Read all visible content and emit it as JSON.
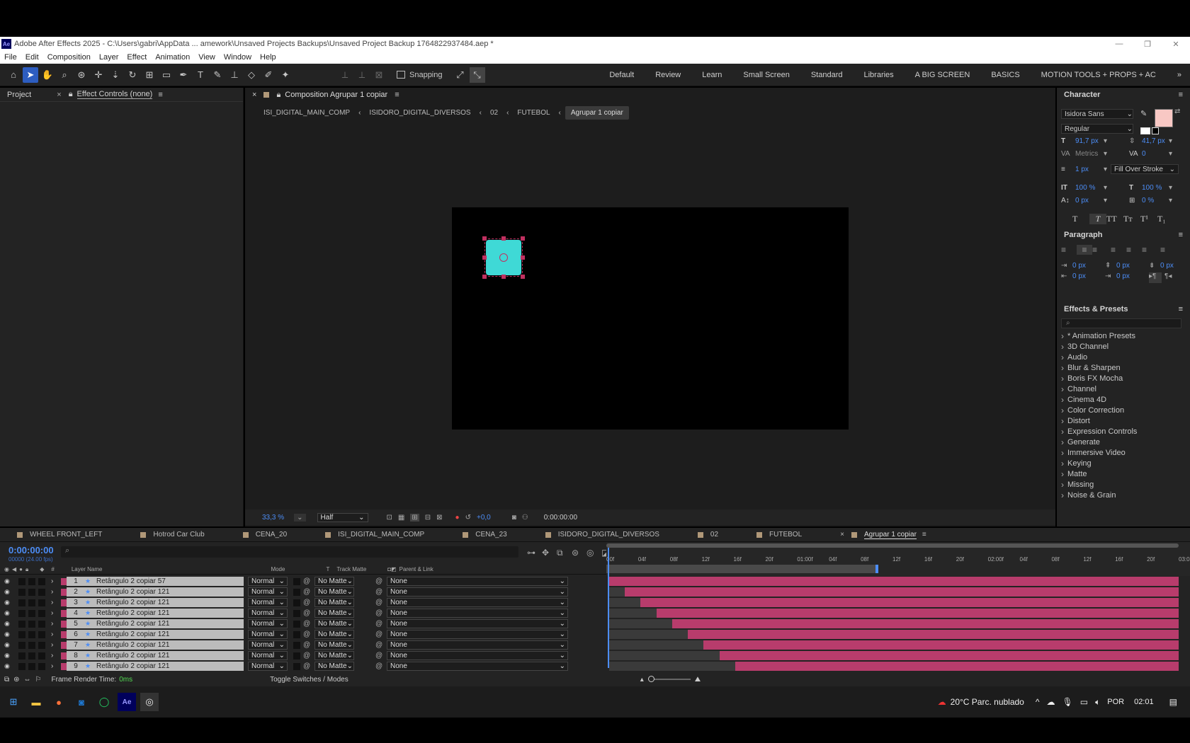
{
  "window": {
    "title": "Adobe After Effects 2025 - C:\\Users\\gabri\\AppData ... amework\\Unsaved Projects Backups\\Unsaved Project Backup 1764822937484.aep *",
    "app_icon": "Ae"
  },
  "menu": [
    "File",
    "Edit",
    "Composition",
    "Layer",
    "Effect",
    "Animation",
    "View",
    "Window",
    "Help"
  ],
  "toolbar": {
    "snapping_label": "Snapping",
    "workspaces": [
      "Default",
      "Review",
      "Learn",
      "Small Screen",
      "Standard",
      "Libraries",
      "A BIG SCREEN",
      "BASICS",
      "MOTION TOOLS + PROPS + AC"
    ]
  },
  "left_panel": {
    "tab_project": "Project",
    "tab_effect": "Effect Controls (none)"
  },
  "comp_panel": {
    "tab": "Composition Agrupar 1 copiar",
    "breadcrumbs": [
      "ISI_DIGITAL_MAIN_COMP",
      "ISIDORO_DIGITAL_DIVERSOS",
      "02",
      "FUTEBOL",
      "Agrupar 1 copiar"
    ],
    "zoom": "33,3 %",
    "resolution": "Half",
    "exposure": "+0,0",
    "timecode": "0:00:00:00",
    "shape_color": "#3fd9d6"
  },
  "character": {
    "title": "Character",
    "font": "Isidora Sans",
    "style": "Regular",
    "size": "91,7 px",
    "leading": "41,7 px",
    "kerning": "Metrics",
    "tracking": "0",
    "stroke_width": "1 px",
    "stroke_mode": "Fill Over Stroke",
    "vscale": "100 %",
    "hscale": "100 %",
    "baseline": "0 px",
    "tsume": "0 %",
    "fill_color": "#f8c8c4"
  },
  "paragraph": {
    "title": "Paragraph",
    "indent_left": "0 px",
    "indent_right": "0 px",
    "space_before": "0 px",
    "indent_first": "0 px",
    "space_after": "0 px",
    "last": "0 px"
  },
  "effects": {
    "title": "Effects & Presets",
    "items": [
      "* Animation Presets",
      "3D Channel",
      "Audio",
      "Blur & Sharpen",
      "Boris FX Mocha",
      "Channel",
      "Cinema 4D",
      "Color Correction",
      "Distort",
      "Expression Controls",
      "Generate",
      "Immersive Video",
      "Keying",
      "Matte",
      "Missing",
      "Noise & Grain"
    ]
  },
  "timeline": {
    "tabs": [
      "WHEEL FRONT_LEFT",
      "Hotrod Car Club",
      "CENA_20",
      "ISI_DIGITAL_MAIN_COMP",
      "CENA_23",
      "ISIDORO_DIGITAL_DIVERSOS",
      "02",
      "FUTEBOL",
      "Agrupar 1 copiar"
    ],
    "timecode": "0:00:00:00",
    "fps": "00000 (24.00 fps)",
    "col_layer_name": "Layer Name",
    "col_mode": "Mode",
    "col_t": "T",
    "col_track": "Track Matte",
    "col_parent": "Parent & Link",
    "ruler": [
      "00f",
      "04f",
      "08f",
      "12f",
      "16f",
      "20f",
      "01:00f",
      "04f",
      "08f",
      "12f",
      "16f",
      "20f",
      "02:00f",
      "04f",
      "08f",
      "12f",
      "16f",
      "20f",
      "03:0"
    ],
    "layers": [
      {
        "num": "1",
        "name": "Retângulo 2 copiar 57",
        "mode": "Normal",
        "matte": "No Matte",
        "parent": "None",
        "start": 0.0
      },
      {
        "num": "2",
        "name": "Retângulo 2 copiar 121",
        "mode": "Normal",
        "matte": "No Matte",
        "parent": "None",
        "start": 0.027
      },
      {
        "num": "3",
        "name": "Retângulo 2 copiar 121",
        "mode": "Normal",
        "matte": "No Matte",
        "parent": "None",
        "start": 0.055
      },
      {
        "num": "4",
        "name": "Retângulo 2 copiar 121",
        "mode": "Normal",
        "matte": "No Matte",
        "parent": "None",
        "start": 0.083
      },
      {
        "num": "5",
        "name": "Retângulo 2 copiar 121",
        "mode": "Normal",
        "matte": "No Matte",
        "parent": "None",
        "start": 0.111
      },
      {
        "num": "6",
        "name": "Retângulo 2 copiar 121",
        "mode": "Normal",
        "matte": "No Matte",
        "parent": "None",
        "start": 0.138
      },
      {
        "num": "7",
        "name": "Retângulo 2 copiar 121",
        "mode": "Normal",
        "matte": "No Matte",
        "parent": "None",
        "start": 0.166
      },
      {
        "num": "8",
        "name": "Retângulo 2 copiar 121",
        "mode": "Normal",
        "matte": "No Matte",
        "parent": "None",
        "start": 0.194
      },
      {
        "num": "9",
        "name": "Retângulo 2 copiar 121",
        "mode": "Normal",
        "matte": "No Matte",
        "parent": "None",
        "start": 0.222
      }
    ],
    "render_time_label": "Frame Render Time:",
    "render_time": "0ms",
    "toggle": "Toggle Switches / Modes",
    "bar_color": "#b83c6c"
  },
  "taskbar": {
    "weather": "20°C  Parc. nublado",
    "lang": "POR",
    "time": "02:01"
  }
}
